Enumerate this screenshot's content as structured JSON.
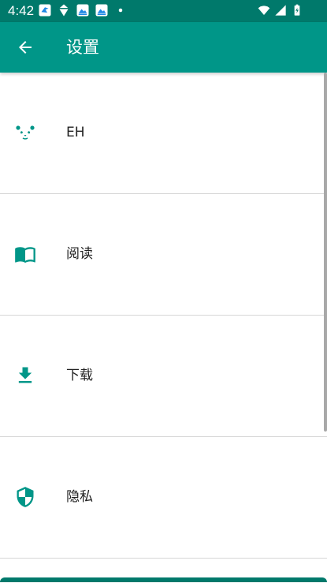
{
  "status_bar": {
    "time": "4:42",
    "left_icons": [
      "bird-notification-icon",
      "diamond-notification-icon",
      "photo-notification-icon",
      "photo-notification-icon",
      "dot-icon"
    ],
    "right_icons": [
      "wifi-icon",
      "signal-icon",
      "battery-icon"
    ],
    "color": "#00796b"
  },
  "app_bar": {
    "title": "设置",
    "back_icon": "arrow-back-icon",
    "color": "#009688"
  },
  "settings": {
    "items": [
      {
        "label": "EH",
        "icon": "panda-icon"
      },
      {
        "label": "阅读",
        "icon": "book-icon"
      },
      {
        "label": "下载",
        "icon": "download-icon"
      },
      {
        "label": "隐私",
        "icon": "shield-icon"
      }
    ],
    "accent_color": "#009688"
  }
}
